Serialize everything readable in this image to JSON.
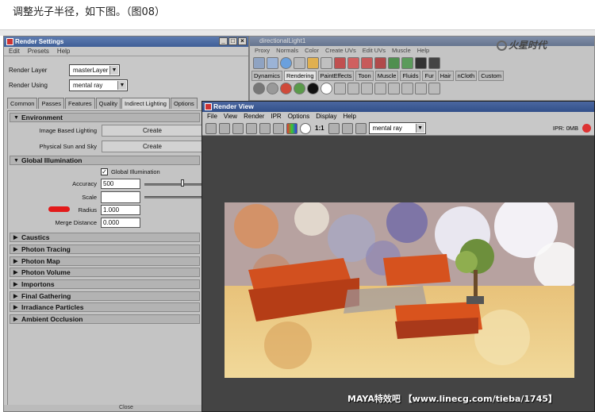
{
  "caption": "调整光子半径，如下图。（图08）",
  "render_settings": {
    "title": "Render Settings",
    "menu": [
      "Edit",
      "Presets",
      "Help"
    ],
    "render_layer_label": "Render Layer",
    "render_layer_value": "masterLayer",
    "render_using_label": "Render Using",
    "render_using_value": "mental ray",
    "tabs": [
      "Common",
      "Passes",
      "Features",
      "Quality",
      "Indirect Lighting",
      "Options"
    ],
    "active_tab": "Indirect Lighting",
    "environment": {
      "header": "Environment",
      "ibl_label": "Image Based Lighting",
      "ibl_button": "Create",
      "sun_label": "Physical Sun and Sky",
      "sun_button": "Create"
    },
    "gi": {
      "header": "Global Illumination",
      "checkbox_label": "Global Illumination",
      "accuracy_label": "Accuracy",
      "accuracy_value": "500",
      "scale_label": "Scale",
      "radius_label": "Radius",
      "radius_value": "1.000",
      "merge_label": "Merge Distance",
      "merge_value": "0.000"
    },
    "sections": [
      "Caustics",
      "Photon Tracing",
      "Photon Map",
      "Photon Volume",
      "Importons",
      "Final Gathering",
      "Irradiance Particles",
      "Ambient Occlusion"
    ],
    "bottom_button": "Close"
  },
  "maya": {
    "title": "directionalLight1",
    "menu": [
      "Proxy",
      "Normals",
      "Color",
      "Create UVs",
      "Edit UVs",
      "Muscle",
      "Help"
    ],
    "shelf_tabs": [
      "Dynamics",
      "Rendering",
      "PaintEffects",
      "Toon",
      "Muscle",
      "Fluids",
      "Fur",
      "Hair",
      "nCloth",
      "Custom"
    ],
    "active_shelf": "Rendering"
  },
  "logo_text": "火星时代",
  "render_view": {
    "title": "Render View",
    "menu": [
      "File",
      "View",
      "Render",
      "IPR",
      "Options",
      "Display",
      "Help"
    ],
    "ratio": "1:1",
    "renderer": "mental ray",
    "ipr_label": "IPR: 0MB"
  },
  "watermark": "MAYA特效吧 【www.linecg.com/tieba/1745】",
  "colors": {
    "title_blue": "#3f5f97",
    "panel_gray": "#c4c4c4",
    "highlight_red": "#e21a1a"
  }
}
